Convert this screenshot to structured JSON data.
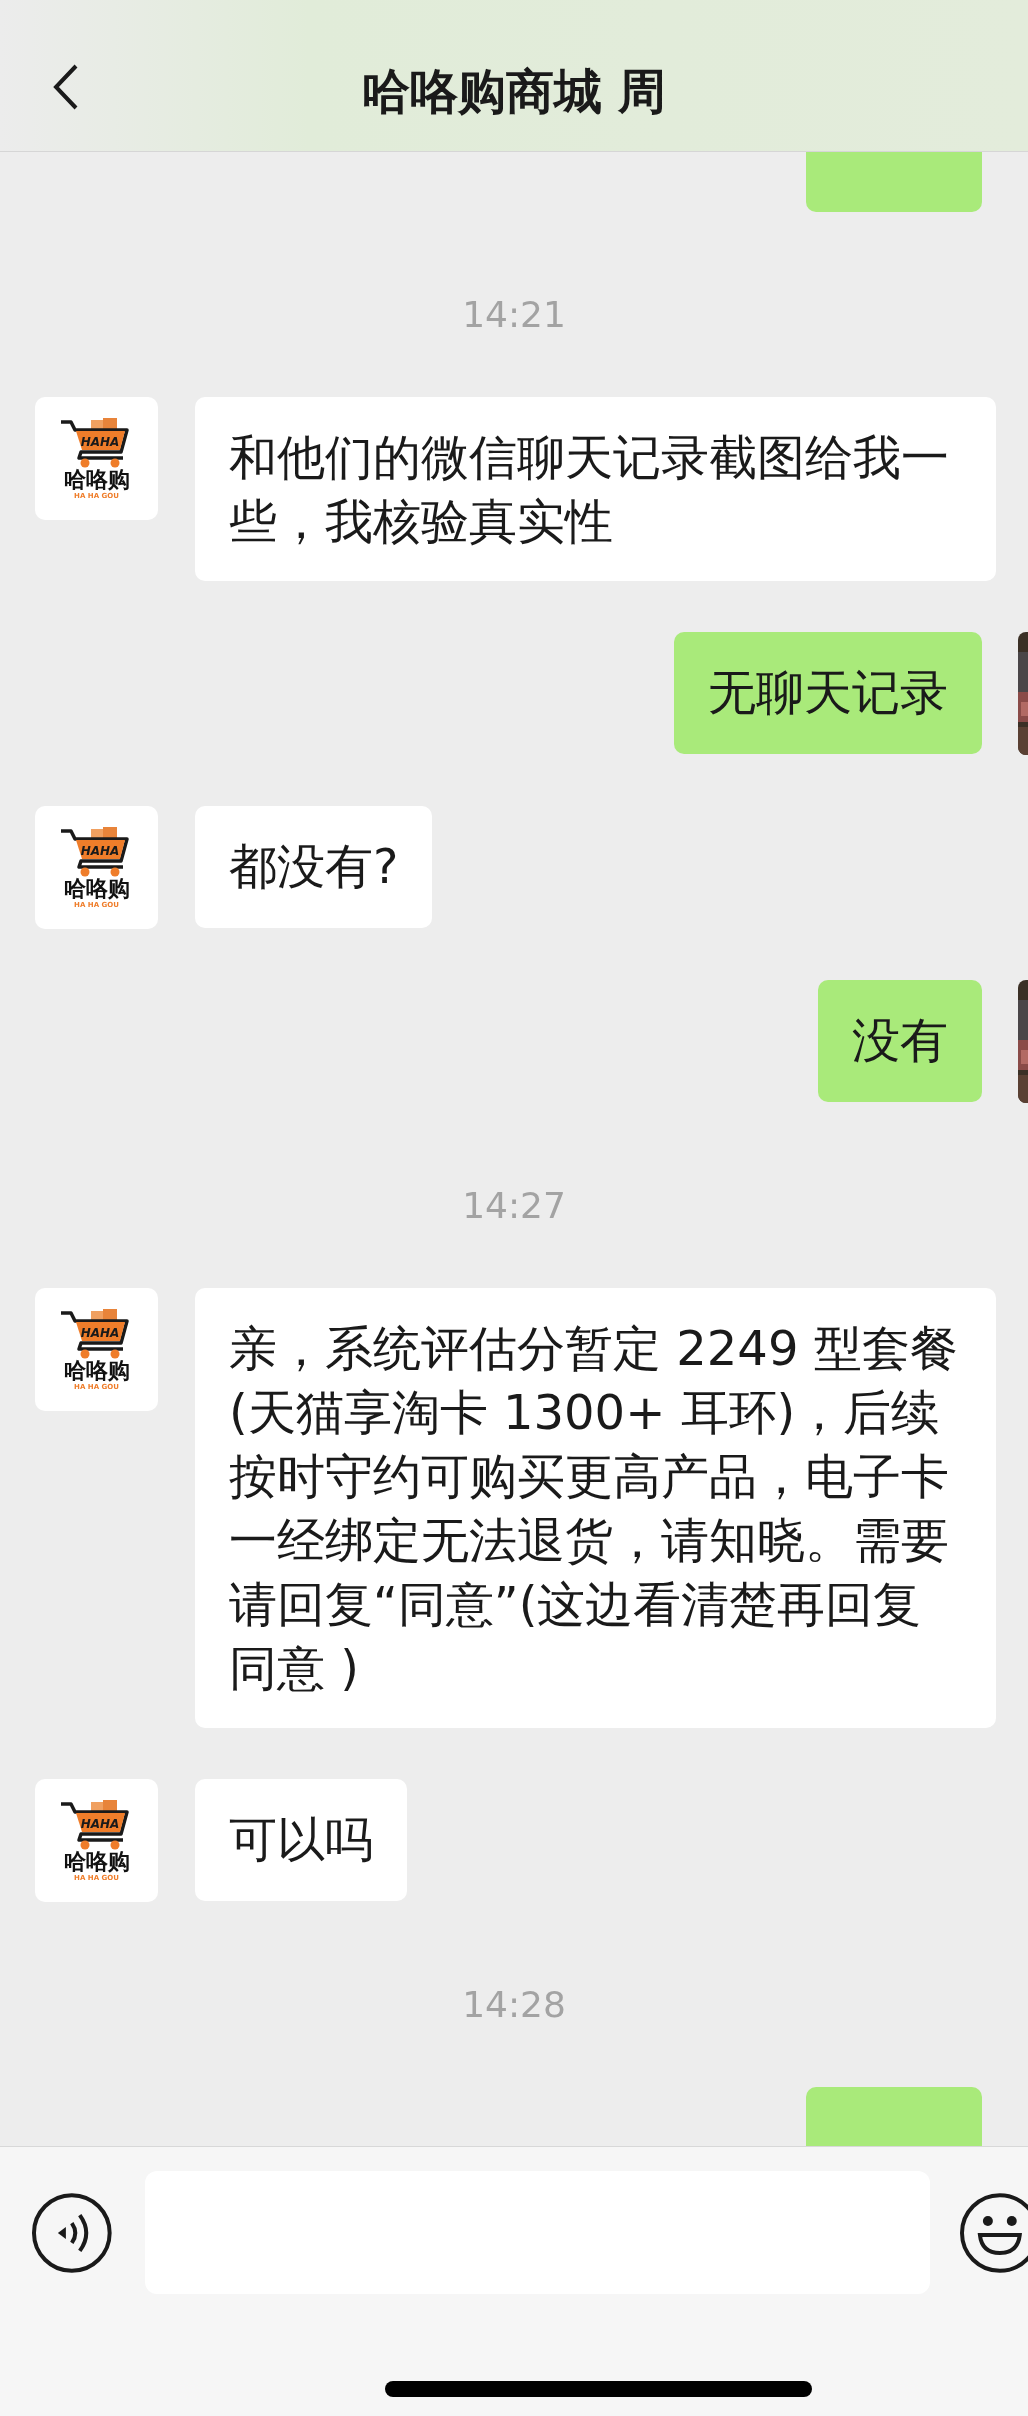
{
  "header": {
    "title": "哈咯购商城 周"
  },
  "messages": [
    {
      "kind": "partial"
    },
    {
      "kind": "time",
      "text": "14:21"
    },
    {
      "kind": "received",
      "text": "和他们的微信聊天记录截图给我一些，我核验真实性",
      "avatar": {
        "badge": "HAHA",
        "name": "哈咯购",
        "caption": "HA HA GOU"
      }
    },
    {
      "kind": "sent",
      "text": "无聊天记录"
    },
    {
      "kind": "received",
      "text": "都没有?",
      "avatar": {
        "badge": "HAHA",
        "name": "哈咯购",
        "caption": "HA HA GOU"
      }
    },
    {
      "kind": "sent",
      "text": "没有"
    },
    {
      "kind": "time",
      "text": "14:27"
    },
    {
      "kind": "received",
      "text": "亲，系统评估分暂定 2249 型套餐 (天猫享淘卡 1300+ 耳环)，后续按时守约可购买更高产品，电子卡一经绑定无法退货，请知晓。需要请回复“同意”(这边看清楚再回复同意 )",
      "avatar": {
        "badge": "HAHA",
        "name": "哈咯购",
        "caption": "HA HA GOU"
      }
    },
    {
      "kind": "received",
      "text": "可以吗",
      "avatar": {
        "badge": "HAHA",
        "name": "哈咯购",
        "caption": "HA HA GOU"
      }
    },
    {
      "kind": "time",
      "text": "14:28"
    },
    {
      "kind": "partial"
    }
  ]
}
